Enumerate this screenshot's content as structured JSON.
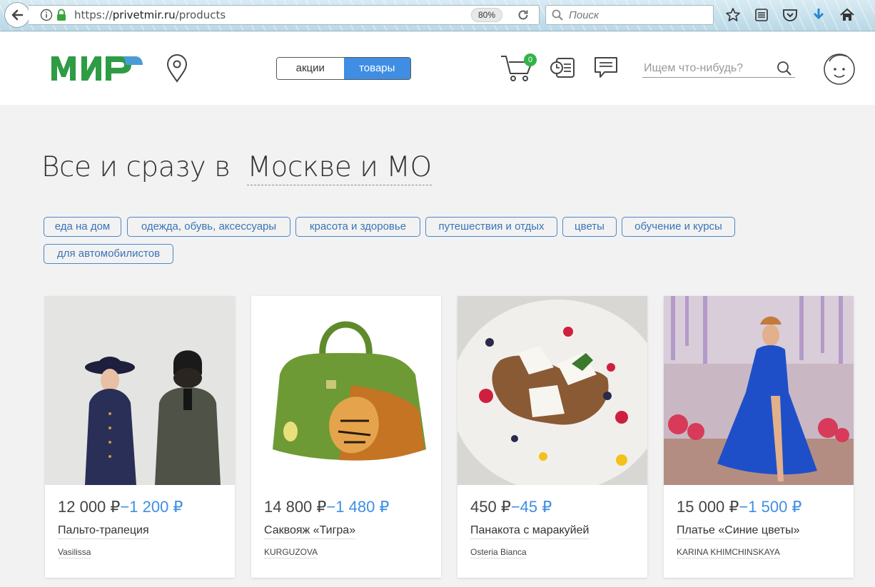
{
  "browser": {
    "url_prefix": "https://",
    "url_host": "privetmir.ru",
    "url_path": "/products",
    "zoom": "80%",
    "search_placeholder": "Поиск"
  },
  "header": {
    "logo_text": "МИР",
    "toggle": [
      {
        "label": "акции",
        "active": false
      },
      {
        "label": "товары",
        "active": true
      }
    ],
    "cart_count": "0",
    "search_placeholder": "Ищем что-нибудь?"
  },
  "headline": {
    "prefix": "Все и сразу в",
    "city": "Москве и МО"
  },
  "categories": [
    "еда на дом",
    "одежда, обувь, аксессуары",
    "красота и здоровье",
    "путешествия и отдых",
    "цветы",
    "обучение и курсы",
    "для автомобилистов"
  ],
  "products": [
    {
      "price": "12 000 ₽",
      "discount": "−1 200 ₽",
      "title": "Пальто-трапеция",
      "shop": "Vasilissa"
    },
    {
      "price": "14 800 ₽",
      "discount": "−1 480 ₽",
      "title": "Саквояж «Тигра»",
      "shop": "KURGUZOVA"
    },
    {
      "price": "450 ₽",
      "discount": "−45 ₽",
      "title": "Панакота с маракуйей",
      "shop": "Osteria Bianca"
    },
    {
      "price": "15 000 ₽",
      "discount": "−1 500 ₽",
      "title": "Платье «Синие цветы»",
      "shop": "KARINA KHIMCHINSKAYA"
    }
  ],
  "colors": {
    "accent": "#3f8ee4",
    "logo_green": "#2f9b45",
    "badge_green": "#33b34a"
  }
}
